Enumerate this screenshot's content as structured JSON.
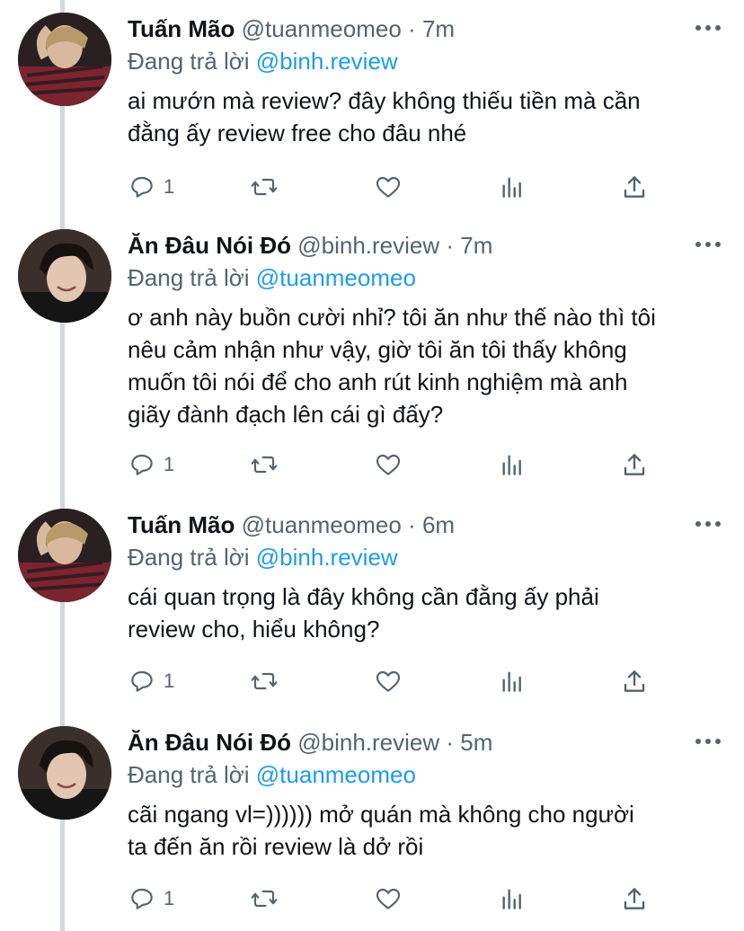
{
  "tweets": [
    {
      "name": "Tuấn Mão",
      "handle": "@tuanmeomeo",
      "dot": "·",
      "time": "7m",
      "replying_prefix": "Đang trả lời ",
      "replying_to": "@binh.review",
      "lines": [
        "ai mướn mà review? đây không thiếu tiền mà cần",
        "đằng ấy review free cho đâu nhé"
      ],
      "reply_count": "1"
    },
    {
      "name": "Ăn Đâu Nói Đó",
      "handle": "@binh.review",
      "dot": "·",
      "time": "7m",
      "replying_prefix": "Đang trả lời ",
      "replying_to": "@tuanmeomeo",
      "lines": [
        "ơ anh này buồn cười nhỉ? tôi ăn như thế nào thì tôi",
        "nêu cảm nhận như vậy, giờ tôi ăn tôi thấy không",
        "muốn tôi nói để cho anh rút kinh nghiệm mà anh",
        "giãy đành đạch lên cái gì đấy?"
      ],
      "reply_count": "1"
    },
    {
      "name": "Tuấn Mão",
      "handle": "@tuanmeomeo",
      "dot": "·",
      "time": "6m",
      "replying_prefix": "Đang trả lời ",
      "replying_to": "@binh.review",
      "lines": [
        "cái quan trọng là đây không cần đằng ấy phải",
        "review cho, hiểu không?"
      ],
      "reply_count": "1"
    },
    {
      "name": "Ăn Đâu Nói Đó",
      "handle": "@binh.review",
      "dot": "·",
      "time": "5m",
      "replying_prefix": "Đang trả lời ",
      "replying_to": "@tuanmeomeo",
      "lines": [
        "cãi ngang vl=)))))) mở quán mà không cho người",
        "ta đến ăn rồi review là dở rồi"
      ],
      "reply_count": "1"
    }
  ],
  "icons": {
    "reply": "reply-icon",
    "retweet": "retweet-icon",
    "like": "heart-icon",
    "analytics": "analytics-icon",
    "share": "share-icon",
    "more": "more-icon"
  },
  "colors": {
    "link": "#1d9bf0",
    "secondary_text": "#536471",
    "thread_line": "#cfd9de"
  }
}
